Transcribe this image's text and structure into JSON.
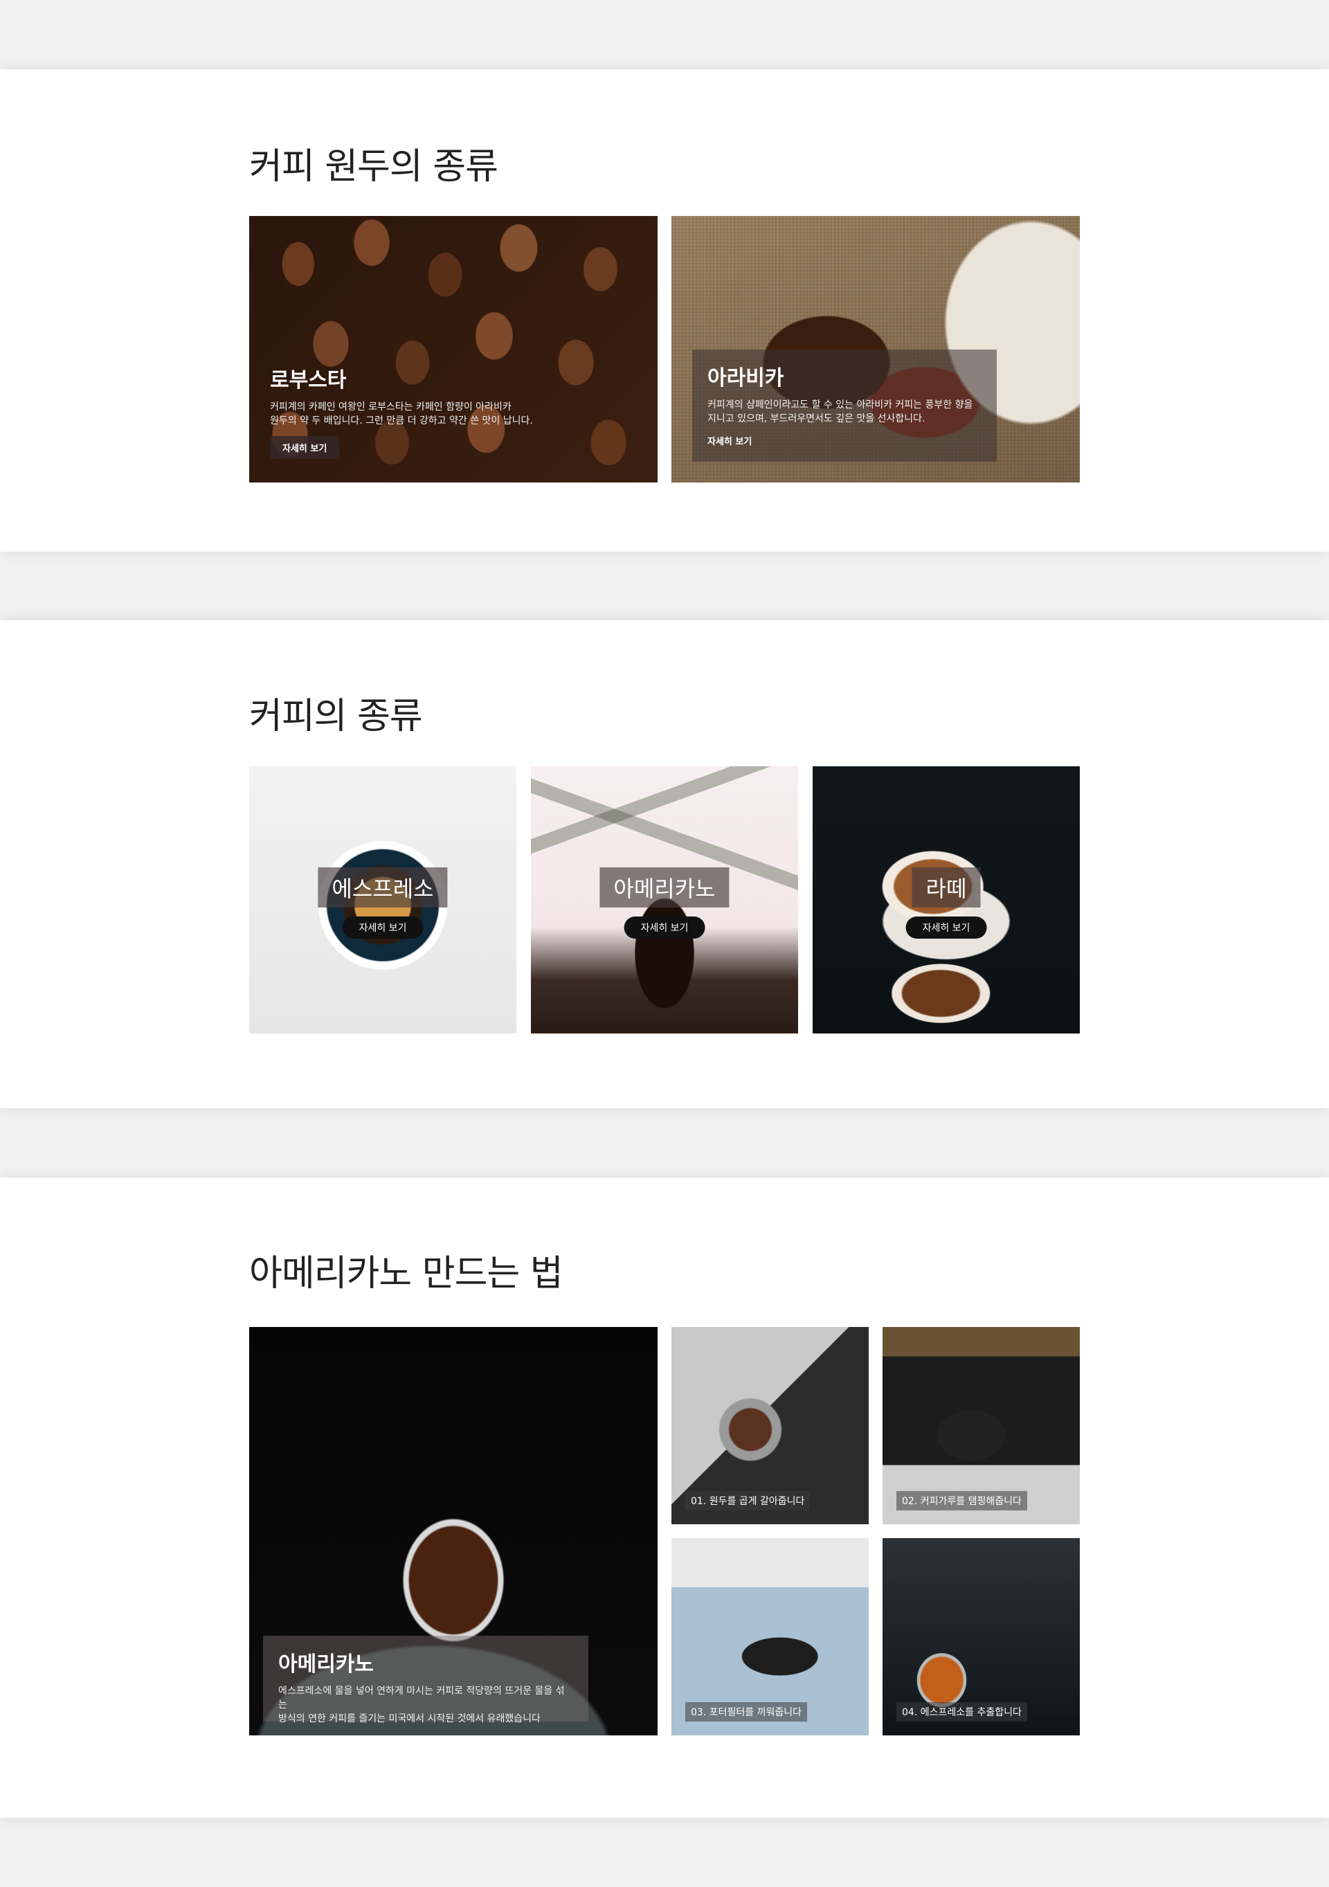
{
  "beans_section": {
    "title": "커피 원두의 종류",
    "cards": [
      {
        "title": "로부스타",
        "desc_line1": "커피계의 카페인 여왕인 로부스타는 카페인 함량이 아라비카",
        "desc_line2": "원두의 약 두 배입니다. 그런 만큼 더 강하고 약간 쓴 맛이 납니다.",
        "button": "자세히 보기"
      },
      {
        "title": "아라비카",
        "desc_line1": "커피계의 샴페인이라고도 할 수 있는 아라비카 커피는 풍부한 향을",
        "desc_line2": "지니고 있으며, 부드러우면서도 깊은 맛을 선사합니다.",
        "button": "자세히 보기"
      }
    ]
  },
  "types_section": {
    "title": "커피의 종류",
    "cards": [
      {
        "label": "에스프레소",
        "button": "자세히 보기"
      },
      {
        "label": "아메리카노",
        "button": "자세히 보기"
      },
      {
        "label": "라떼",
        "button": "자세히 보기"
      }
    ]
  },
  "howto_section": {
    "title": "아메리카노 만드는 법",
    "main": {
      "title": "아메리카노",
      "desc_line1": "에스프레소에 물을 넣어 연하게 마시는 커피로 적당량의 뜨거운 물을 섞는",
      "desc_line2": "방식의 연한 커피를 즐기는 미국에서 시작된 것에서 유래했습니다"
    },
    "steps": [
      "01. 원두를 곱게 갈아줍니다",
      "02. 커피가루를 탬핑해줍니다",
      "03. 포터필터를 끼워줍니다",
      "04. 에스프레소를 추출합니다"
    ]
  }
}
